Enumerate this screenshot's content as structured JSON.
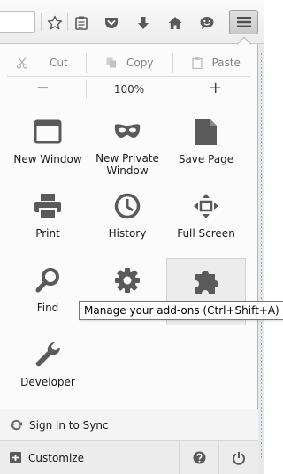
{
  "toolbar": {
    "icons": [
      "star-icon",
      "reading-list-icon",
      "pocket-icon",
      "download-icon",
      "home-icon",
      "chat-icon"
    ],
    "menu_button_icon": "hamburger-icon"
  },
  "panel": {
    "edit": {
      "cut": "Cut",
      "copy": "Copy",
      "paste": "Paste"
    },
    "zoom": {
      "minus": "−",
      "level": "100%",
      "plus": "+"
    },
    "items": [
      {
        "label": "New Window",
        "icon": "window-icon"
      },
      {
        "label": "New Private\nWindow",
        "icon": "private-mask-icon"
      },
      {
        "label": "Save Page",
        "icon": "page-icon"
      },
      {
        "label": "Print",
        "icon": "printer-icon"
      },
      {
        "label": "History",
        "icon": "clock-icon"
      },
      {
        "label": "Full Screen",
        "icon": "fullscreen-icon"
      },
      {
        "label": "Find",
        "icon": "magnifier-icon"
      },
      {
        "label": "",
        "icon": "gear-icon"
      },
      {
        "label": "",
        "icon": "puzzle-icon"
      },
      {
        "label": "Developer",
        "icon": "wrench-icon"
      }
    ],
    "tooltip": "Manage your add-ons (Ctrl+Shift+A)",
    "sync_label": "Sign in to Sync",
    "customize_label": "Customize"
  },
  "colors": {
    "icon": "#5a5a5a",
    "panel_bg": "#fbfbfb",
    "footer_bg": "#ececec",
    "hover_bg": "#ececec"
  }
}
